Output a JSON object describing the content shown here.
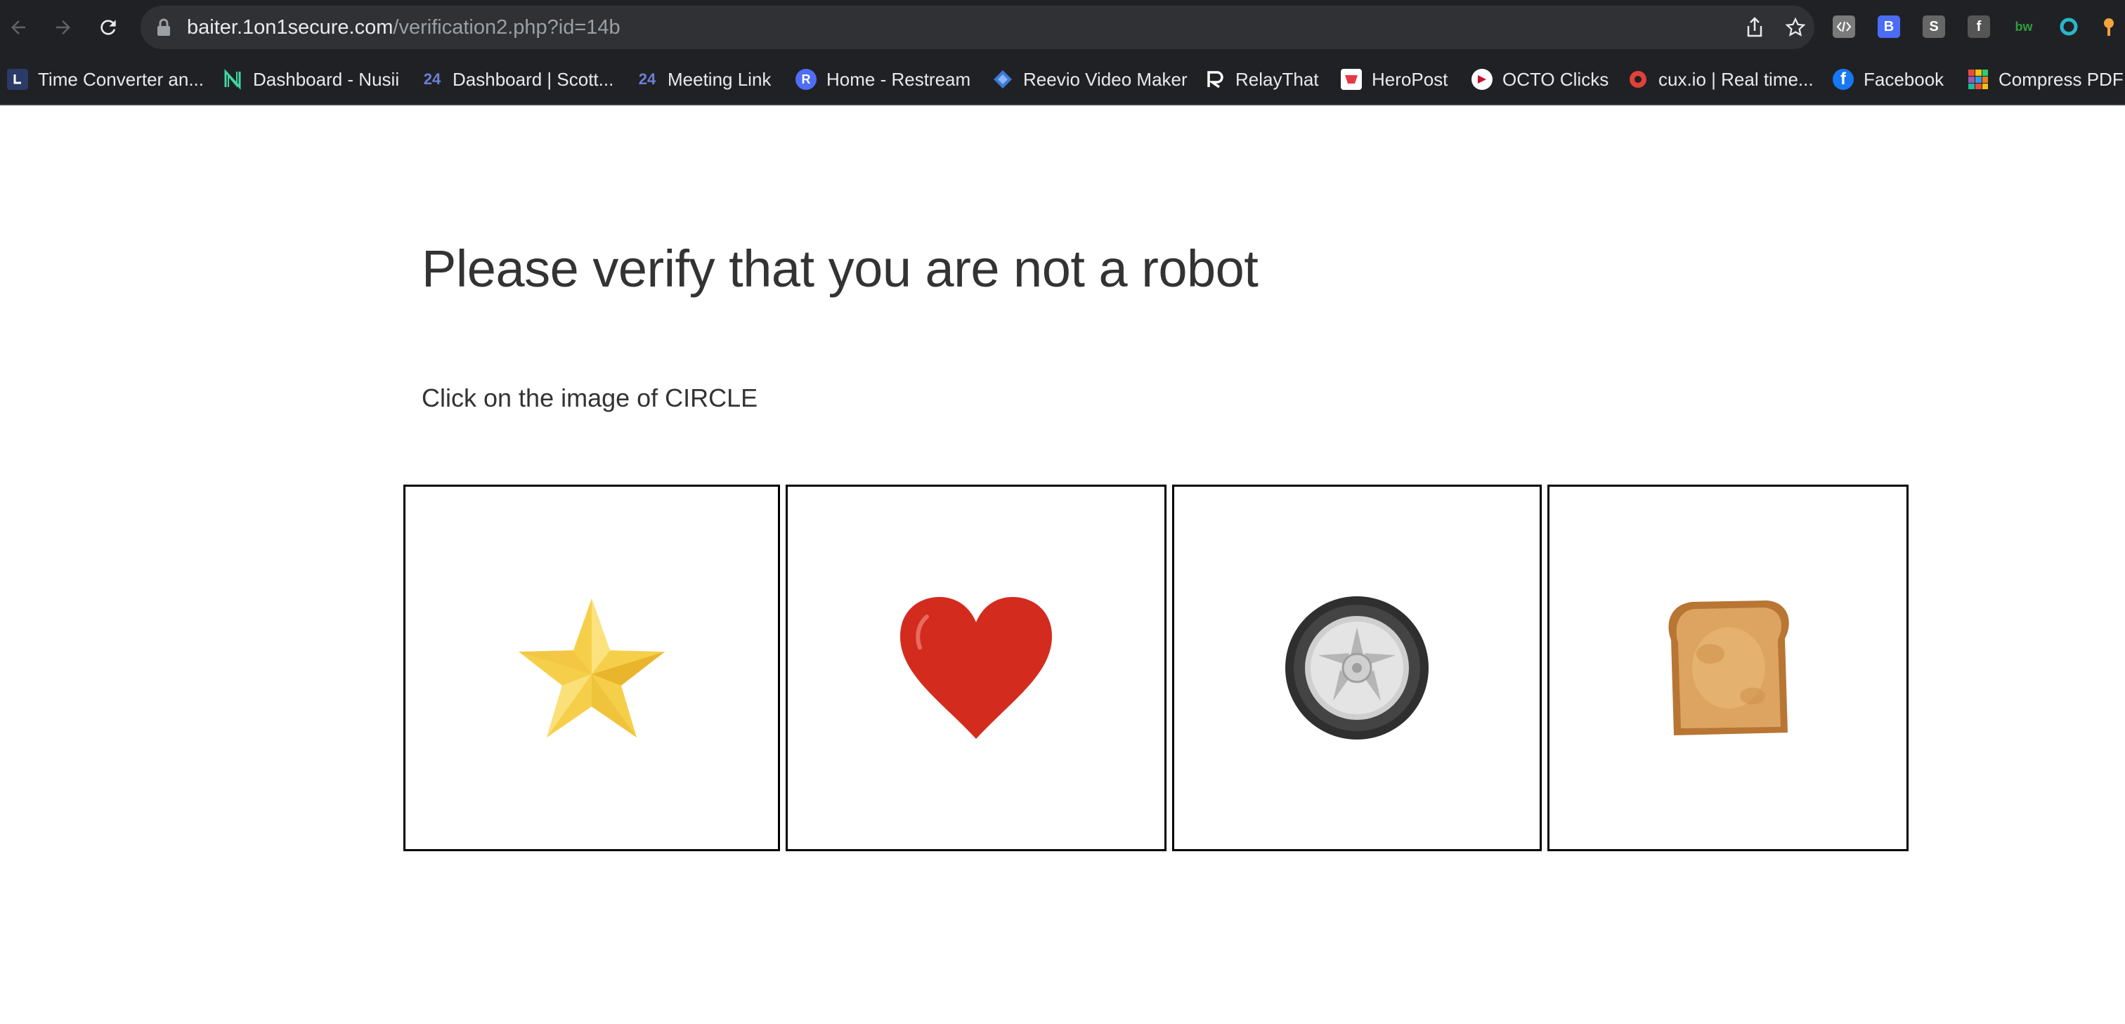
{
  "browser": {
    "url_host": "baiter.1on1secure.com",
    "url_path": "/verification2.php?id=14b",
    "bookmarks": [
      {
        "label": "Time Converter an...",
        "icon": "clock-icon"
      },
      {
        "label": "Dashboard - Nusii",
        "icon": "nusii-logo-icon"
      },
      {
        "label": "Dashboard | Scott...",
        "icon": "24-logo-icon",
        "icon_text": "24"
      },
      {
        "label": "Meeting Link",
        "icon": "24-logo-icon",
        "icon_text": "24"
      },
      {
        "label": "Home - Restream",
        "icon": "restream-logo-icon",
        "icon_text": "R"
      },
      {
        "label": "Reevio Video Maker",
        "icon": "reevio-logo-icon"
      },
      {
        "label": "RelayThat",
        "icon": "relaythat-logo-icon"
      },
      {
        "label": "HeroPost",
        "icon": "heropost-logo-icon"
      },
      {
        "label": "OCTO Clicks",
        "icon": "octo-logo-icon"
      },
      {
        "label": "cux.io | Real time...",
        "icon": "cux-logo-icon"
      },
      {
        "label": "Facebook",
        "icon": "facebook-icon",
        "icon_text": "f"
      },
      {
        "label": "Compress PDF",
        "icon": "compress-pdf-icon"
      }
    ],
    "extensions_text": {
      "s": "S",
      "f": "f",
      "bw": "bw",
      "b": "B"
    }
  },
  "page": {
    "title": "Please verify that you are not a robot",
    "instruction": "Click on the image of CIRCLE",
    "options": [
      {
        "name": "star",
        "icon": "star-icon"
      },
      {
        "name": "heart",
        "icon": "heart-icon"
      },
      {
        "name": "wheel",
        "icon": "wheel-icon"
      },
      {
        "name": "toast",
        "icon": "toast-icon"
      }
    ]
  },
  "colors": {
    "toolbar_bg": "#202124",
    "omnibox_bg": "#303134",
    "heading_text": "#333333",
    "tile_border": "#000000",
    "star": "#f6cf4a",
    "heart": "#d42b1f",
    "tire": "#3a3a3a",
    "toast": "#d9a35a"
  }
}
